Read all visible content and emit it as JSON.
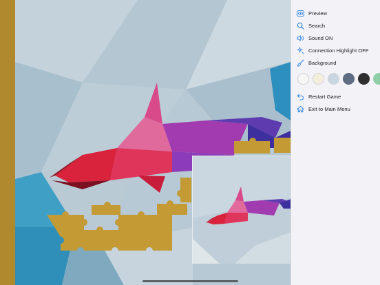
{
  "menu": {
    "items": [
      {
        "label": "Preview",
        "icon": "eye-icon"
      },
      {
        "label": "Search",
        "icon": "search-icon"
      },
      {
        "label": "Sound ON",
        "icon": "speaker-icon"
      },
      {
        "label": "Connection Highlight OFF",
        "icon": "sparkle-icon"
      },
      {
        "label": "Background",
        "icon": "paintbrush-icon"
      }
    ],
    "footer": [
      {
        "label": "Restart Game",
        "icon": "undo-arrow-icon"
      },
      {
        "label": "Exit to Main Menu",
        "icon": "home-icon"
      }
    ],
    "accent_color": "#1f7ae0"
  },
  "background_swatches": [
    {
      "name": "white",
      "color": "#f7f7f7"
    },
    {
      "name": "cream",
      "color": "#f3efdc"
    },
    {
      "name": "light-blue",
      "color": "#c9d6e2"
    },
    {
      "name": "slate",
      "color": "#5e6d82"
    },
    {
      "name": "black",
      "color": "#2e2e2e"
    },
    {
      "name": "mint",
      "color": "#8fcfa7"
    }
  ],
  "board": {
    "frame_color": "#b0882e",
    "piece_color": "#c39a34"
  }
}
